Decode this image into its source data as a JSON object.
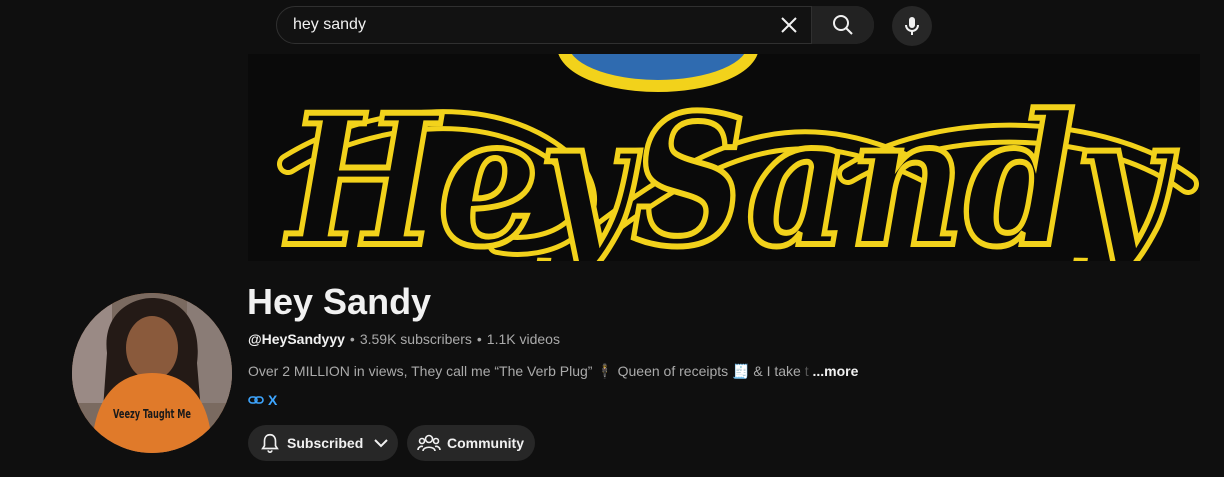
{
  "search": {
    "value": "hey sandy",
    "placeholder": "Search"
  },
  "icons": {
    "clear": "close-icon",
    "search": "search-icon",
    "mic": "microphone-icon",
    "bell": "bell-icon",
    "chevron": "chevron-down-icon",
    "community": "people-icon",
    "link": "link-icon"
  },
  "banner": {
    "logo_text": "HeySandy"
  },
  "avatar": {
    "shirt_text": "Veezy Taught Me"
  },
  "channel": {
    "title": "Hey Sandy",
    "handle": "@HeySandyyy",
    "sep1": "•",
    "subscribers": "3.59K subscribers",
    "sep2": "•",
    "videos": "1.1K videos",
    "description": "Over 2 MILLION in views, They call me “The Verb Plug” 🕴 Queen of receipts 🧾 & I take",
    "description_fade": " t",
    "more": "...more",
    "link_label": "X"
  },
  "buttons": {
    "subscribed": "Subscribed",
    "community": "Community"
  },
  "colors": {
    "background": "#0f0f0f",
    "logo_yellow": "#f2d21b",
    "link_blue": "#3ea6ff",
    "button_bg": "#272727"
  }
}
